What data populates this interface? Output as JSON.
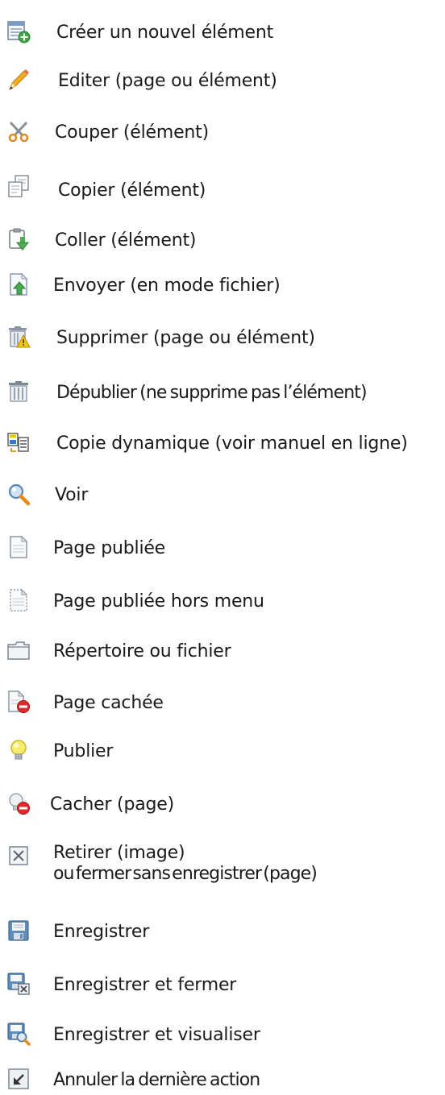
{
  "items": [
    {
      "icon": "new-element-icon",
      "label": "Créer un nouvel élément"
    },
    {
      "icon": "pencil-edit-icon",
      "label": "Editer (page ou élément)"
    },
    {
      "icon": "scissors-cut-icon",
      "label": "Couper (élément)"
    },
    {
      "icon": "copy-icon",
      "label": "Copier (élément)"
    },
    {
      "icon": "paste-clipboard-icon",
      "label": "Coller (élément)"
    },
    {
      "icon": "upload-file-icon",
      "label": "Envoyer (en mode fichier)"
    },
    {
      "icon": "trash-warning-icon",
      "label": "Supprimer (page ou élément)"
    },
    {
      "icon": "trash-icon",
      "label": "Dépublier (ne supprime pas l’élément)"
    },
    {
      "icon": "dynamic-copy-icon",
      "label": "Copie dynamique (voir manuel en ligne)"
    },
    {
      "icon": "magnifier-view-icon",
      "label": "Voir"
    },
    {
      "icon": "published-page-icon",
      "label": "Page publiée"
    },
    {
      "icon": "published-page-offmenu-icon",
      "label": "Page publiée hors menu"
    },
    {
      "icon": "folder-icon",
      "label": "Répertoire ou fichier"
    },
    {
      "icon": "hidden-page-icon",
      "label": "Page cachée"
    },
    {
      "icon": "lightbulb-publish-icon",
      "label": "Publier"
    },
    {
      "icon": "hide-page-icon",
      "label": "Cacher (page)"
    },
    {
      "icon": "remove-close-icon",
      "label": "Retirer (image)",
      "label2": "ou fermer sans enregistrer (page)"
    },
    {
      "icon": "save-floppy-icon",
      "label": "Enregistrer"
    },
    {
      "icon": "save-close-icon",
      "label": "Enregistrer et fermer"
    },
    {
      "icon": "save-preview-icon",
      "label": "Enregistrer et visualiser"
    },
    {
      "icon": "undo-icon",
      "label": "Annuler la dernière action"
    }
  ]
}
